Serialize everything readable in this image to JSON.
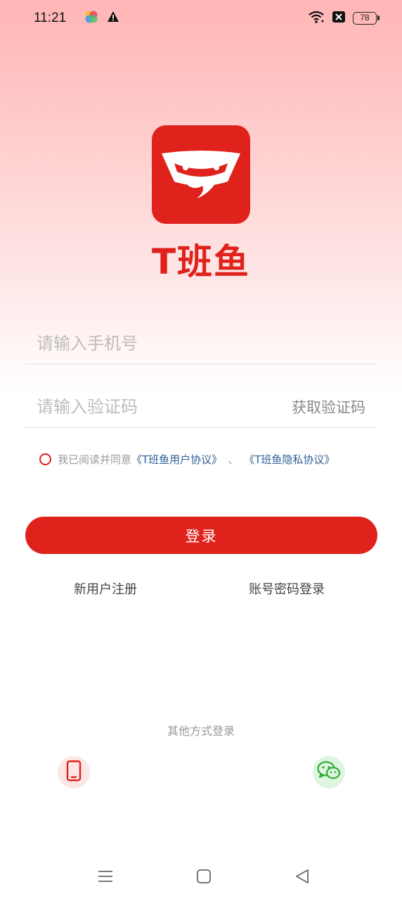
{
  "status_bar": {
    "time": "11:21",
    "battery": "78",
    "left_icons": [
      "colorful-app-icon",
      "warning-icon"
    ],
    "right_icons": [
      "wifi-icon",
      "sim-off-icon",
      "battery-icon"
    ]
  },
  "brand": {
    "name": "T班鱼",
    "color": "#e0221c"
  },
  "form": {
    "phone_placeholder": "请输入手机号",
    "code_placeholder": "请输入验证码",
    "get_code_label": "获取验证码"
  },
  "agreement": {
    "prefix": "我已阅读并同意",
    "user_agreement": "《T班鱼用户协议》",
    "separator": "、",
    "privacy_agreement": "《T班鱼隐私协议》"
  },
  "actions": {
    "login_label": "登录",
    "register_label": "新用户注册",
    "password_login_label": "账号密码登录"
  },
  "other_login": {
    "title": "其他方式登录",
    "options": [
      "phone-icon",
      "wechat-icon"
    ]
  },
  "nav": {
    "icons": [
      "menu-icon",
      "home-icon",
      "back-icon"
    ]
  }
}
